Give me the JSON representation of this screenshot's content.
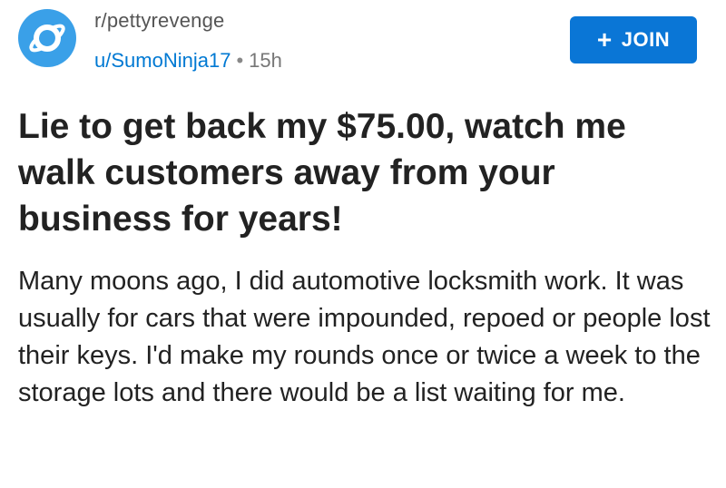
{
  "post": {
    "subreddit": "r/pettyrevenge",
    "username": "u/SumoNinja17",
    "separator": "•",
    "age": "15h",
    "join_label": "JOIN",
    "join_icon": "plus-icon",
    "title": "Lie to get back my $75.00, watch me walk customers away from your business for years!",
    "body": "Many moons ago, I did automotive locksmith work.   It was usually for cars that were impounded, repoed or people lost their keys.  I'd make my rounds once or twice a week to the storage lots and there would be a list waiting for me."
  },
  "colors": {
    "avatar_bg": "#3aa0e8",
    "join_bg": "#0a76d6",
    "username": "#0079d3"
  }
}
